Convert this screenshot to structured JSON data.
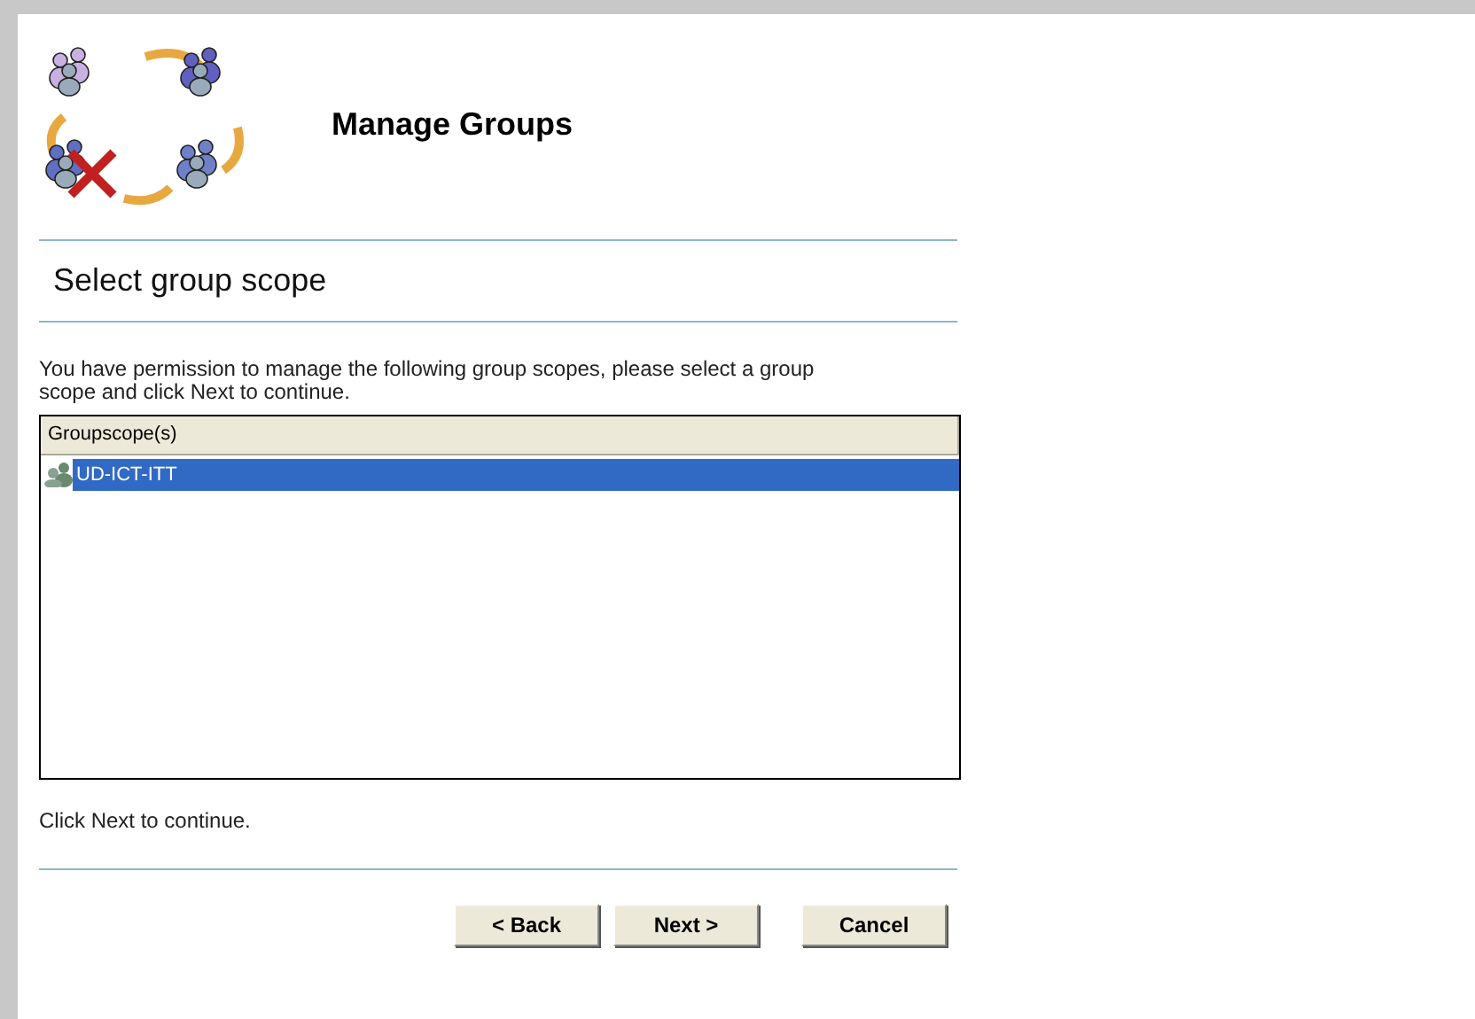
{
  "header": {
    "title": "Manage Groups"
  },
  "section": {
    "title": "Select group scope"
  },
  "instructions": "You have permission to manage the following group scopes, please select a group scope and click Next to continue.",
  "list": {
    "columns": [
      "Groupscope(s)"
    ],
    "rows": [
      {
        "name": "UD-ICT-ITT",
        "selected": true
      }
    ]
  },
  "hint": "Click Next to continue.",
  "buttons": [
    {
      "label": "< Back",
      "kind": "back"
    },
    {
      "label": "Next >",
      "kind": "next"
    },
    {
      "label": "Cancel",
      "kind": "cancel"
    }
  ]
}
